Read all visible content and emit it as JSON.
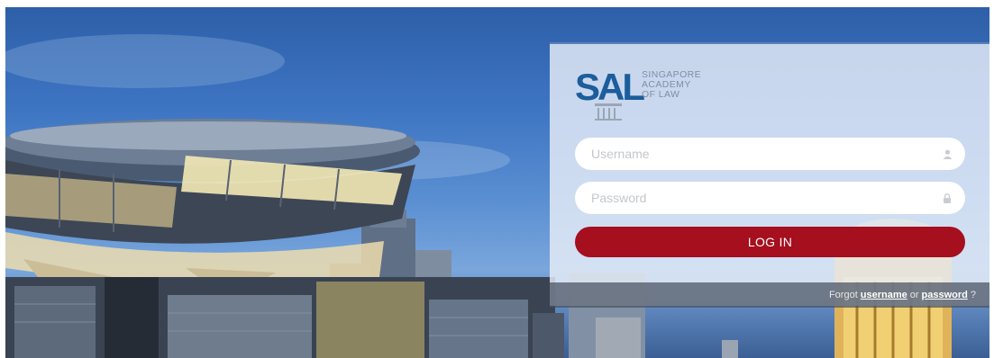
{
  "brand": {
    "mark": "SAL",
    "name_lines": [
      "SINGAPORE",
      "ACADEMY",
      "OF LAW"
    ],
    "color": "#1c5d9c"
  },
  "login": {
    "username_placeholder": "Username",
    "password_placeholder": "Password",
    "username_icon": "user-icon",
    "password_icon": "lock-icon",
    "button_label": "LOG IN",
    "button_color": "#a50f1e"
  },
  "forgot": {
    "prefix": "Forgot",
    "username_link": "username",
    "connector": "or",
    "password_link": "password",
    "suffix": "?"
  }
}
